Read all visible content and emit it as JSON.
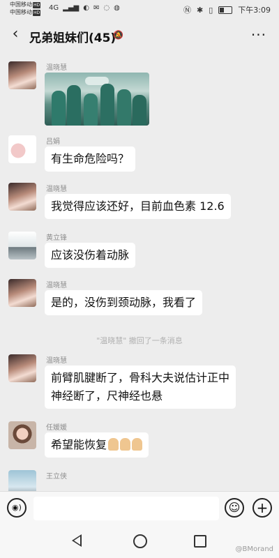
{
  "status_bar": {
    "carrier_1": "中国移动",
    "carrier_2": "中国移动",
    "hd_label": "HD",
    "network": "4G",
    "time": "下午3:09"
  },
  "header": {
    "title": "兄弟姐妹们(45)",
    "more_label": "···"
  },
  "messages": [
    {
      "sender": "温晓慧",
      "type": "image"
    },
    {
      "sender": "吕娟",
      "type": "text",
      "text": "有生命危险吗？"
    },
    {
      "sender": "温晓慧",
      "type": "text",
      "text": "我觉得应该还好，目前血色素 12.6"
    },
    {
      "sender": "黄立锋",
      "type": "text",
      "text": "应该没伤着动脉"
    },
    {
      "sender": "温晓慧",
      "type": "text",
      "text": "是的，没伤到颈动脉，我看了"
    },
    {
      "type": "system",
      "text": "\"温晓慧\" 撤回了一条消息"
    },
    {
      "sender": "温晓慧",
      "type": "text",
      "text": "前臂肌腱断了，骨科大夫说估计正中神经断了，尺神经也悬"
    },
    {
      "sender": "任媛媛",
      "type": "text",
      "text": "希望能恢复"
    },
    {
      "sender": "王立侠",
      "type": "text",
      "text": ""
    }
  ],
  "input_bar": {
    "voice_label": "◉)",
    "emoji_label": "☺",
    "plus_label": "+"
  },
  "watermark": "@BMorand"
}
